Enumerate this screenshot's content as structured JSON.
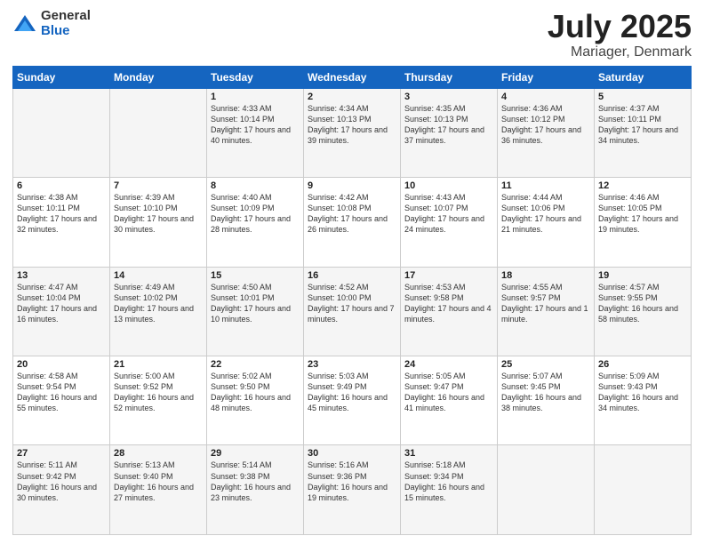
{
  "logo": {
    "general": "General",
    "blue": "Blue"
  },
  "title": "July 2025",
  "location": "Mariager, Denmark",
  "headers": [
    "Sunday",
    "Monday",
    "Tuesday",
    "Wednesday",
    "Thursday",
    "Friday",
    "Saturday"
  ],
  "weeks": [
    [
      {
        "day": "",
        "detail": ""
      },
      {
        "day": "",
        "detail": ""
      },
      {
        "day": "1",
        "detail": "Sunrise: 4:33 AM\nSunset: 10:14 PM\nDaylight: 17 hours and 40 minutes."
      },
      {
        "day": "2",
        "detail": "Sunrise: 4:34 AM\nSunset: 10:13 PM\nDaylight: 17 hours and 39 minutes."
      },
      {
        "day": "3",
        "detail": "Sunrise: 4:35 AM\nSunset: 10:13 PM\nDaylight: 17 hours and 37 minutes."
      },
      {
        "day": "4",
        "detail": "Sunrise: 4:36 AM\nSunset: 10:12 PM\nDaylight: 17 hours and 36 minutes."
      },
      {
        "day": "5",
        "detail": "Sunrise: 4:37 AM\nSunset: 10:11 PM\nDaylight: 17 hours and 34 minutes."
      }
    ],
    [
      {
        "day": "6",
        "detail": "Sunrise: 4:38 AM\nSunset: 10:11 PM\nDaylight: 17 hours and 32 minutes."
      },
      {
        "day": "7",
        "detail": "Sunrise: 4:39 AM\nSunset: 10:10 PM\nDaylight: 17 hours and 30 minutes."
      },
      {
        "day": "8",
        "detail": "Sunrise: 4:40 AM\nSunset: 10:09 PM\nDaylight: 17 hours and 28 minutes."
      },
      {
        "day": "9",
        "detail": "Sunrise: 4:42 AM\nSunset: 10:08 PM\nDaylight: 17 hours and 26 minutes."
      },
      {
        "day": "10",
        "detail": "Sunrise: 4:43 AM\nSunset: 10:07 PM\nDaylight: 17 hours and 24 minutes."
      },
      {
        "day": "11",
        "detail": "Sunrise: 4:44 AM\nSunset: 10:06 PM\nDaylight: 17 hours and 21 minutes."
      },
      {
        "day": "12",
        "detail": "Sunrise: 4:46 AM\nSunset: 10:05 PM\nDaylight: 17 hours and 19 minutes."
      }
    ],
    [
      {
        "day": "13",
        "detail": "Sunrise: 4:47 AM\nSunset: 10:04 PM\nDaylight: 17 hours and 16 minutes."
      },
      {
        "day": "14",
        "detail": "Sunrise: 4:49 AM\nSunset: 10:02 PM\nDaylight: 17 hours and 13 minutes."
      },
      {
        "day": "15",
        "detail": "Sunrise: 4:50 AM\nSunset: 10:01 PM\nDaylight: 17 hours and 10 minutes."
      },
      {
        "day": "16",
        "detail": "Sunrise: 4:52 AM\nSunset: 10:00 PM\nDaylight: 17 hours and 7 minutes."
      },
      {
        "day": "17",
        "detail": "Sunrise: 4:53 AM\nSunset: 9:58 PM\nDaylight: 17 hours and 4 minutes."
      },
      {
        "day": "18",
        "detail": "Sunrise: 4:55 AM\nSunset: 9:57 PM\nDaylight: 17 hours and 1 minute."
      },
      {
        "day": "19",
        "detail": "Sunrise: 4:57 AM\nSunset: 9:55 PM\nDaylight: 16 hours and 58 minutes."
      }
    ],
    [
      {
        "day": "20",
        "detail": "Sunrise: 4:58 AM\nSunset: 9:54 PM\nDaylight: 16 hours and 55 minutes."
      },
      {
        "day": "21",
        "detail": "Sunrise: 5:00 AM\nSunset: 9:52 PM\nDaylight: 16 hours and 52 minutes."
      },
      {
        "day": "22",
        "detail": "Sunrise: 5:02 AM\nSunset: 9:50 PM\nDaylight: 16 hours and 48 minutes."
      },
      {
        "day": "23",
        "detail": "Sunrise: 5:03 AM\nSunset: 9:49 PM\nDaylight: 16 hours and 45 minutes."
      },
      {
        "day": "24",
        "detail": "Sunrise: 5:05 AM\nSunset: 9:47 PM\nDaylight: 16 hours and 41 minutes."
      },
      {
        "day": "25",
        "detail": "Sunrise: 5:07 AM\nSunset: 9:45 PM\nDaylight: 16 hours and 38 minutes."
      },
      {
        "day": "26",
        "detail": "Sunrise: 5:09 AM\nSunset: 9:43 PM\nDaylight: 16 hours and 34 minutes."
      }
    ],
    [
      {
        "day": "27",
        "detail": "Sunrise: 5:11 AM\nSunset: 9:42 PM\nDaylight: 16 hours and 30 minutes."
      },
      {
        "day": "28",
        "detail": "Sunrise: 5:13 AM\nSunset: 9:40 PM\nDaylight: 16 hours and 27 minutes."
      },
      {
        "day": "29",
        "detail": "Sunrise: 5:14 AM\nSunset: 9:38 PM\nDaylight: 16 hours and 23 minutes."
      },
      {
        "day": "30",
        "detail": "Sunrise: 5:16 AM\nSunset: 9:36 PM\nDaylight: 16 hours and 19 minutes."
      },
      {
        "day": "31",
        "detail": "Sunrise: 5:18 AM\nSunset: 9:34 PM\nDaylight: 16 hours and 15 minutes."
      },
      {
        "day": "",
        "detail": ""
      },
      {
        "day": "",
        "detail": ""
      }
    ]
  ]
}
